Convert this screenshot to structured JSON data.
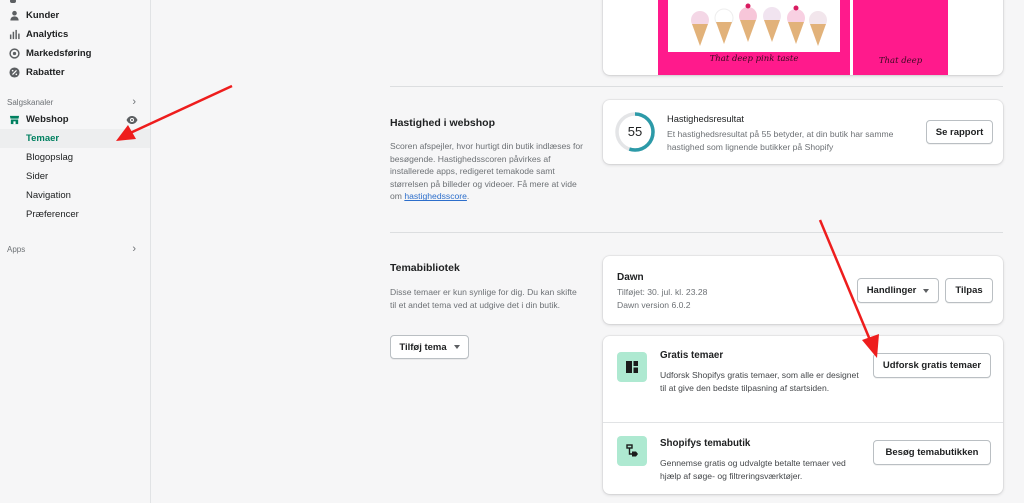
{
  "sidebar": {
    "items": [
      {
        "label": "Kunder",
        "icon": "person-icon"
      },
      {
        "label": "Analytics",
        "icon": "bar-chart-icon"
      },
      {
        "label": "Markedsføring",
        "icon": "target-icon"
      },
      {
        "label": "Rabatter",
        "icon": "discount-icon"
      }
    ],
    "sales_channels_label": "Salgskanaler",
    "webshop_label": "Webshop",
    "webshop_sub": [
      "Temaer",
      "Blogopslag",
      "Sider",
      "Navigation",
      "Præferencer"
    ],
    "apps_label": "Apps"
  },
  "theme_preview": {
    "caption_left": "That deep pink taste",
    "caption_right": "That deep"
  },
  "speed": {
    "title": "Hastighed i webshop",
    "description": "Scoren afspejler, hvor hurtigt din butik indlæses for besøgende. Hastighedsscoren påvirkes af installerede apps, redigeret temakode samt størrelsen på billeder og videoer. Få mere at vide om ",
    "link": "hastighedsscore",
    "link_suffix": ".",
    "score": "55",
    "score_fraction": 0.55,
    "card_title": "Hastighedsresultat",
    "card_text": "Et hastighedsresultat på 55 betyder, at din butik har samme hastighed som lignende butikker på Shopify",
    "report_button": "Se rapport"
  },
  "library": {
    "title": "Temabibliotek",
    "description": "Disse temaer er kun synlige for dig. Du kan skifte til et andet tema ved at udgive det i din butik.",
    "add_button": "Tilføj tema",
    "theme_name": "Dawn",
    "theme_added": "Tilføjet: 30. jul. kl. 23.28",
    "theme_version": "Dawn version 6.0.2",
    "actions_button": "Handlinger",
    "customize_button": "Tilpas",
    "free_title": "Gratis temaer",
    "free_text": "Udforsk Shopifys gratis temaer, som alle er designet til at give den bedste tilpasning af startsiden.",
    "free_button": "Udforsk gratis temaer",
    "store_title": "Shopifys temabutik",
    "store_text": "Gennemse gratis og udvalgte betalte temaer ved hjælp af søge- og filtreringsværktøjer.",
    "store_button": "Besøg temabutikken"
  },
  "colors": {
    "accent": "#008060",
    "pink": "#ff1a8c",
    "arrow": "#ee1d1d",
    "icon_bg": "#aee9d1"
  }
}
